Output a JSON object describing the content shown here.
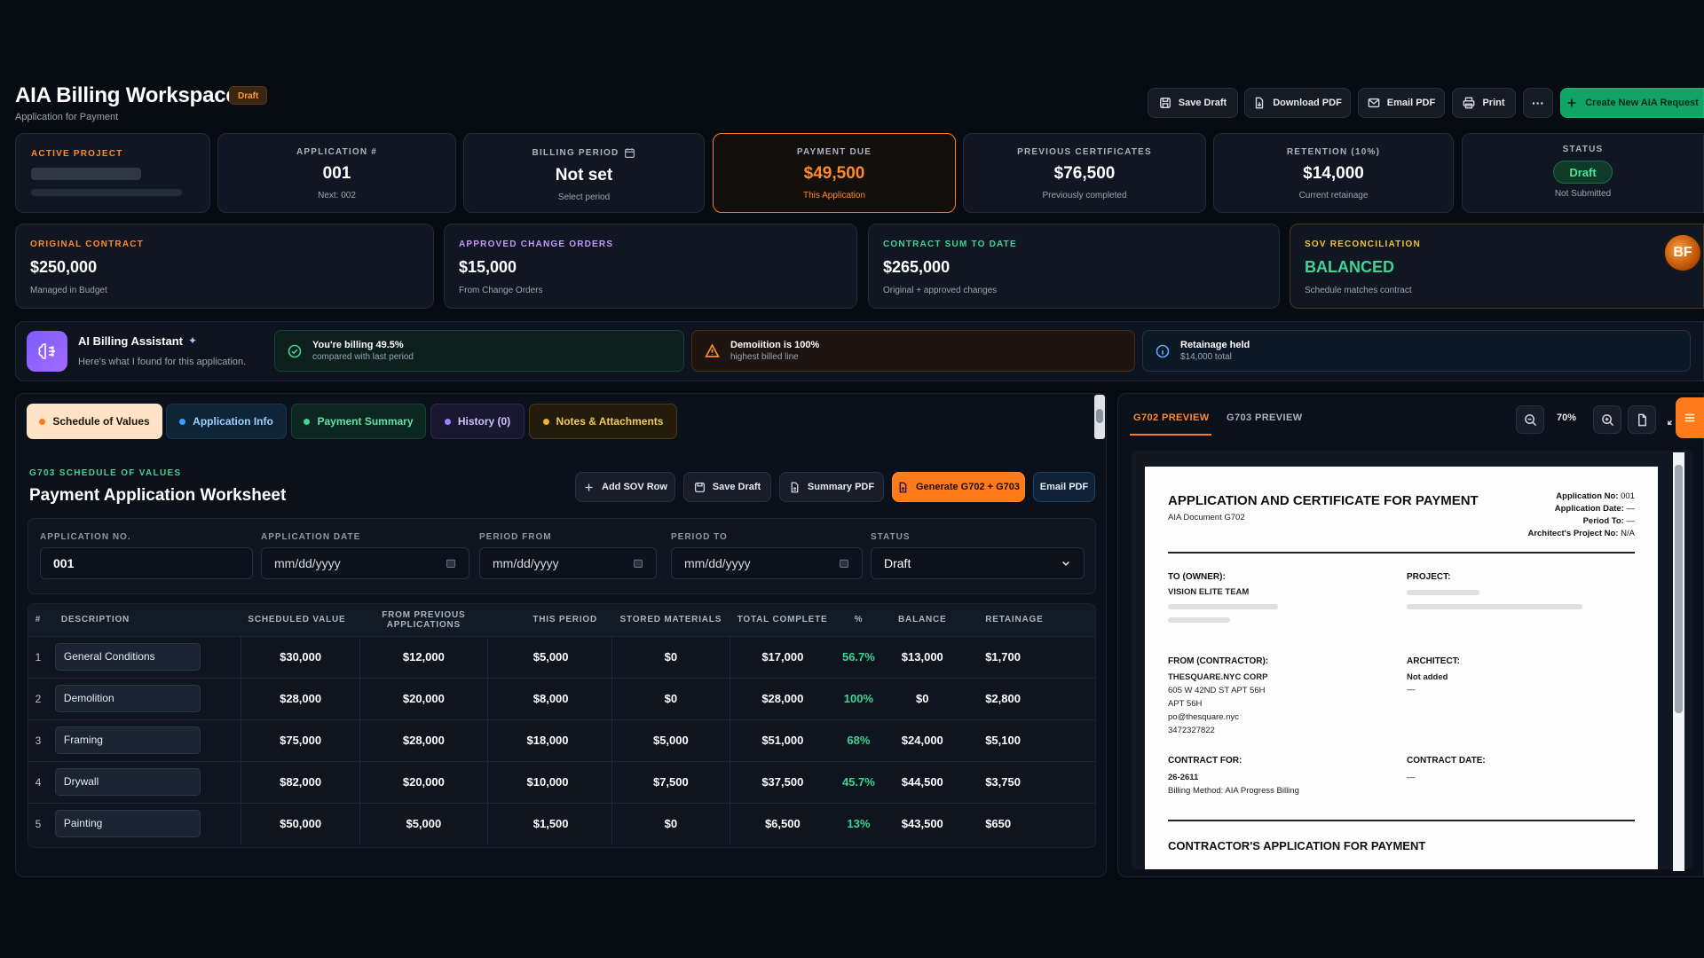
{
  "header": {
    "title": "AIA Billing Workspace",
    "badge": "Draft",
    "subtitle": "Application for Payment"
  },
  "toolbar": {
    "save_draft": "Save Draft",
    "download_pdf": "Download PDF",
    "email_pdf": "Email PDF",
    "print": "Print",
    "more": "···",
    "create_new": "Create New AIA Request"
  },
  "summary_cards": {
    "active_project": {
      "label": "Active Project"
    },
    "application": {
      "label": "Application #",
      "value": "001",
      "sub": "Next: 002"
    },
    "billing_period": {
      "label": "Billing Period",
      "value": "Not set",
      "sub": "Select period"
    },
    "payment_due": {
      "label": "Payment Due",
      "value": "$49,500",
      "sub": "This Application"
    },
    "previous_certificates": {
      "label": "Previous Certificates",
      "value": "$76,500",
      "sub": "Previously completed"
    },
    "retention": {
      "label": "Retention (10%)",
      "value": "$14,000",
      "sub": "Current retainage"
    },
    "status": {
      "label": "Status",
      "value": "Draft",
      "sub": "Not Submitted"
    }
  },
  "contract_cards": {
    "original": {
      "label": "Original Contract",
      "value": "$250,000",
      "sub": "Managed in Budget"
    },
    "change_orders": {
      "label": "Approved Change Orders",
      "value": "$15,000",
      "sub": "From Change Orders"
    },
    "sum_to_date": {
      "label": "Contract Sum to Date",
      "value": "$265,000",
      "sub": "Original + approved changes"
    },
    "reconciliation": {
      "label": "SOV Reconciliation",
      "value": "BALANCED",
      "sub": "Schedule matches contract",
      "avatar": "BF"
    }
  },
  "ai_assistant": {
    "title": "AI Billing Assistant",
    "sparkle": "✦",
    "sub": "Here's what I found for this application.",
    "insights": [
      {
        "title": "You're billing 49.5%",
        "sub": "compared with last period"
      },
      {
        "title": "Demoiition is 100%",
        "sub": "highest billed line"
      },
      {
        "title": "Retainage held",
        "sub": "$14,000 total"
      }
    ]
  },
  "tabs": [
    {
      "label": "Schedule of Values"
    },
    {
      "label": "Application Info"
    },
    {
      "label": "Payment Summary"
    },
    {
      "label": "History (0)"
    },
    {
      "label": "Notes & Attachments"
    }
  ],
  "worksheet": {
    "eyebrow": "G703 Schedule of Values",
    "title": "Payment Application Worksheet",
    "buttons": {
      "add_row": "Add SOV Row",
      "save_draft": "Save Draft",
      "summary_pdf": "Summary PDF",
      "generate": "Generate G702 + G703",
      "email_pdf": "Email PDF"
    },
    "fields": {
      "application_no": {
        "label": "Application No.",
        "value": "001"
      },
      "application_date": {
        "label": "Application Date",
        "placeholder": "mm/dd/yyyy"
      },
      "period_from": {
        "label": "Period From",
        "placeholder": "mm/dd/yyyy"
      },
      "period_to": {
        "label": "Period To",
        "placeholder": "mm/dd/yyyy"
      },
      "status": {
        "label": "Status",
        "value": "Draft"
      }
    },
    "columns": [
      "#",
      "Description",
      "Scheduled Value",
      "From Previous Applications",
      "This Period",
      "Stored Materials",
      "Total Complete",
      "%",
      "Balance",
      "Retainage"
    ],
    "rows": [
      {
        "n": "1",
        "desc": "General Conditions",
        "scheduled": "$30,000",
        "previous": "$12,000",
        "period": "$5,000",
        "stored": "$0",
        "total": "$17,000",
        "pct": "56.7%",
        "balance": "$13,000",
        "retainage": "$1,700"
      },
      {
        "n": "2",
        "desc": "Demolition",
        "scheduled": "$28,000",
        "previous": "$20,000",
        "period": "$8,000",
        "stored": "$0",
        "total": "$28,000",
        "pct": "100%",
        "balance": "$0",
        "retainage": "$2,800"
      },
      {
        "n": "3",
        "desc": "Framing",
        "scheduled": "$75,000",
        "previous": "$28,000",
        "period": "$18,000",
        "stored": "$5,000",
        "total": "$51,000",
        "pct": "68%",
        "balance": "$24,000",
        "retainage": "$5,100"
      },
      {
        "n": "4",
        "desc": "Drywall",
        "scheduled": "$82,000",
        "previous": "$20,000",
        "period": "$10,000",
        "stored": "$7,500",
        "total": "$37,500",
        "pct": "45.7%",
        "balance": "$44,500",
        "retainage": "$3,750"
      },
      {
        "n": "5",
        "desc": "Painting",
        "scheduled": "$50,000",
        "previous": "$5,000",
        "period": "$1,500",
        "stored": "$0",
        "total": "$6,500",
        "pct": "13%",
        "balance": "$43,500",
        "retainage": "$650"
      }
    ]
  },
  "preview": {
    "tabs": [
      "G702 Preview",
      "G703 Preview"
    ],
    "zoom": "70%",
    "doc": {
      "title": "APPLICATION AND CERTIFICATE FOR PAYMENT",
      "subtitle": "AIA Document G702",
      "meta": [
        {
          "k": "Application No:",
          "v": "001"
        },
        {
          "k": "Application Date:",
          "v": "—"
        },
        {
          "k": "Period To:",
          "v": "—"
        },
        {
          "k": "Architect's Project No:",
          "v": "N/A"
        }
      ],
      "to_owner_label": "TO (OWNER):",
      "to_owner": "VISION ELITE TEAM",
      "project_label": "PROJECT:",
      "from_label": "FROM (CONTRACTOR):",
      "from_lines": [
        "THESQUARE.NYC CORP",
        "605 W 42ND ST APT 56H",
        "APT 56H",
        "po@thesquare.nyc",
        "3472327822"
      ],
      "architect_label": "ARCHITECT:",
      "architect": "Not added",
      "architect_sub": "—",
      "contract_for_label": "CONTRACT FOR:",
      "contract_for": "26-2611",
      "billing_method": "Billing Method: AIA Progress Billing",
      "contract_date_label": "CONTRACT DATE:",
      "contract_date": "—",
      "section": "CONTRACTOR'S APPLICATION FOR PAYMENT"
    }
  },
  "colors": {
    "accent_orange": "#ff7a1a",
    "accent_green": "#11a466",
    "success": "#3fd493",
    "background": "#070b12"
  }
}
